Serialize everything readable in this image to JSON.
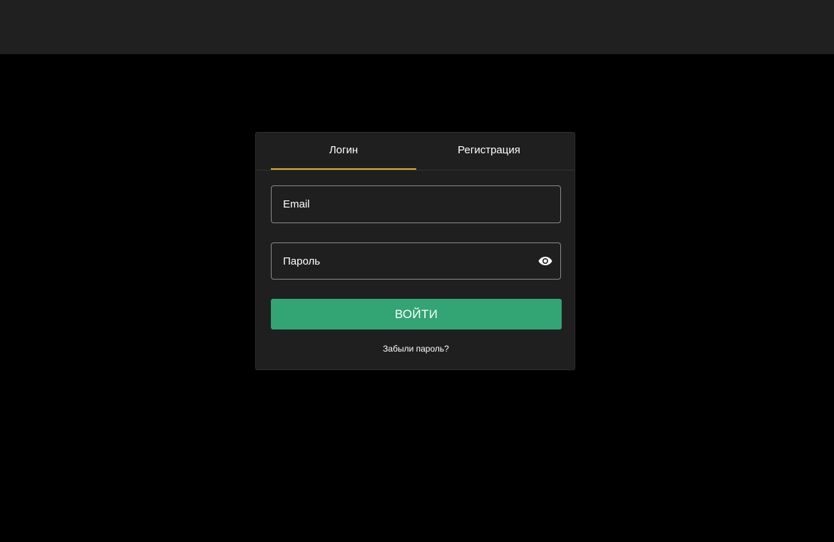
{
  "tabs": {
    "login_label": "Логин",
    "register_label": "Регистрация",
    "active": "login"
  },
  "form": {
    "email_placeholder": "Email",
    "password_placeholder": "Пароль",
    "password_toggle_icon": "eye-icon",
    "submit_label": "ВОЙТИ",
    "forgot_label": "Забыли пароль?"
  },
  "colors": {
    "accent_tab": "#e0b020",
    "button": "#33a474",
    "card_bg": "#1f1f1f",
    "topbar_bg": "#202020",
    "page_bg": "#000000"
  }
}
